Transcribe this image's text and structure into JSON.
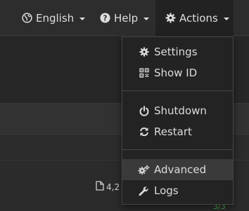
{
  "navbar": {
    "language": {
      "label": "English",
      "icon": "globe-icon"
    },
    "help": {
      "label": "Help",
      "icon": "question-circle-icon"
    },
    "actions": {
      "label": "Actions",
      "icon": "gear-icon"
    }
  },
  "dropdown": {
    "items": [
      {
        "label": "Settings",
        "icon": "gear-icon"
      },
      {
        "label": "Show ID",
        "icon": "qrcode-icon"
      },
      {
        "label": "Shutdown",
        "icon": "power-icon"
      },
      {
        "label": "Restart",
        "icon": "refresh-icon"
      },
      {
        "label": "Advanced",
        "icon": "gears-icon",
        "active": true
      },
      {
        "label": "Logs",
        "icon": "wrench-icon"
      }
    ]
  },
  "content": {
    "file_stat": "4,2",
    "count": "3/3"
  },
  "colors": {
    "navbar_bg": "#2d2d2d",
    "active_nav_bg": "#222222",
    "dropdown_bg": "#232323",
    "count_green": "#4caf50"
  }
}
